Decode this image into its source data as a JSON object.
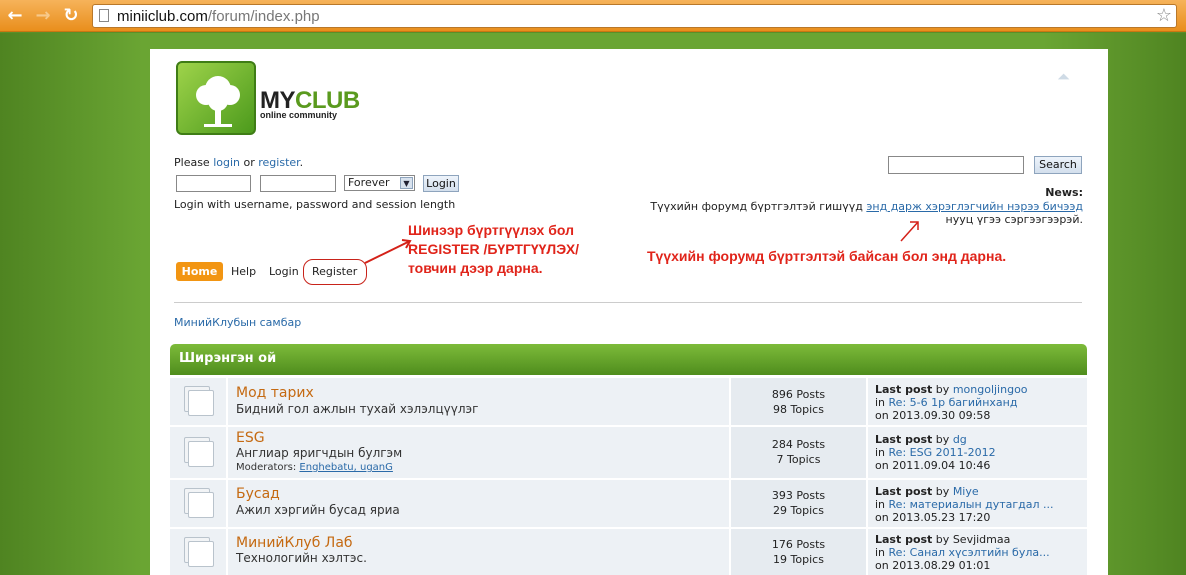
{
  "browser": {
    "url_host": "miniiclub.com",
    "url_path": "/forum/index.php",
    "back_icon": "back-arrow-icon",
    "forward_icon": "forward-arrow-icon",
    "reload_icon": "reload-icon",
    "bookmark_icon": "star-icon"
  },
  "logo": {
    "name_part1": "MY",
    "name_part2": "CLUB",
    "subtitle": "online community"
  },
  "login": {
    "prompt_before": "Please ",
    "login_link": "login",
    "prompt_or": " or ",
    "register_link": "register",
    "prompt_end": ".",
    "username_value": "",
    "password_value": "",
    "session_value": "Forever",
    "login_button": "Login",
    "help_text": "Login with username, password and session length"
  },
  "menu": {
    "home": "Home",
    "help": "Help",
    "login": "Login",
    "register": "Register"
  },
  "annotations": {
    "register_line1": "Шинээр бүртгүүлэх бол",
    "register_line2": "REGISTER /БҮРТГҮҮЛЭХ/",
    "register_line3": "товчин дээр дарна.",
    "news_note": "Түүхийн форумд бүртгэлтэй байсан бол энд дарна."
  },
  "search": {
    "value": "",
    "button": "Search"
  },
  "news": {
    "label": "News:",
    "text_before": "Түүхийн форумд бүртгэлтэй гишүүд ",
    "link": "энд дарж хэрэглэгчийн нэрээ бичээд",
    "text_after": "нууц үгээ сэргээгээрэй."
  },
  "breadcrumb": "МинийКлубын самбар",
  "category": {
    "title": "Ширэнгэн ой"
  },
  "forums": [
    {
      "title": "Мод тарих",
      "desc": "Бидний гол ажлын тухай хэлэлцүүлэг",
      "moderators_label": "",
      "moderators": "",
      "posts": "896 Posts",
      "topics": "98 Topics",
      "last_label": "Last post",
      "last_by": " by ",
      "last_user": "mongoljingoo",
      "last_in": "in ",
      "last_topic": "Re: 5-6 1р багийнханд",
      "last_on": "on 2013.09.30 09:58"
    },
    {
      "title": "ESG",
      "desc": "Англиар яригчдын булгэм",
      "moderators_label": "Moderators: ",
      "moderators": "Enghebatu, uganG",
      "posts": "284 Posts",
      "topics": "7 Topics",
      "last_label": "Last post",
      "last_by": " by ",
      "last_user": "dg",
      "last_in": "in ",
      "last_topic": "Re: ESG 2011-2012",
      "last_on": "on 2011.09.04 10:46"
    },
    {
      "title": "Бусад",
      "desc": "Ажил хэргийн бусад яриа",
      "moderators_label": "",
      "moderators": "",
      "posts": "393 Posts",
      "topics": "29 Topics",
      "last_label": "Last post",
      "last_by": " by ",
      "last_user": "Miye",
      "last_in": "in ",
      "last_topic": "Re: материалын дутагдал ...",
      "last_on": "on 2013.05.23 17:20"
    },
    {
      "title": "МинийКлуб Лаб",
      "desc": "Технологийн хэлтэс.",
      "moderators_label": "",
      "moderators": "",
      "posts": "176 Posts",
      "topics": "19 Topics",
      "last_label": "Last post",
      "last_by": " by ",
      "last_user": "Sevjidmaa",
      "last_in": "in ",
      "last_topic": "Re: Санал хүсэлтийн була...",
      "last_on": "on 2013.08.29 01:01"
    }
  ]
}
